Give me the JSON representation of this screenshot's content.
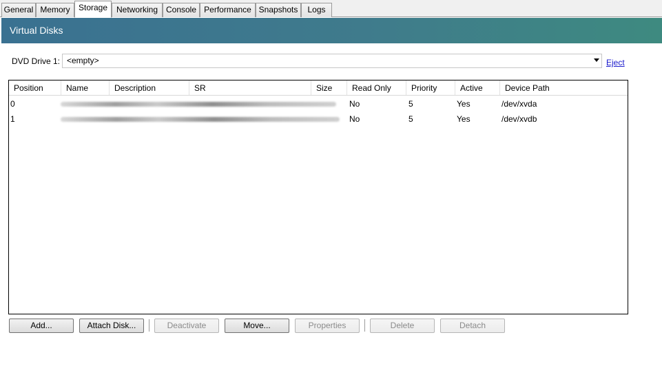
{
  "tabs": [
    {
      "label": "General"
    },
    {
      "label": "Memory"
    },
    {
      "label": "Storage",
      "active": true
    },
    {
      "label": "Networking"
    },
    {
      "label": "Console"
    },
    {
      "label": "Performance"
    },
    {
      "label": "Snapshots"
    },
    {
      "label": "Logs"
    }
  ],
  "header": {
    "title": "Virtual Disks"
  },
  "dvd": {
    "label": "DVD Drive 1:",
    "value": "<empty>",
    "eject_label": "Eject"
  },
  "grid": {
    "columns": [
      "Position",
      "Name",
      "Description",
      "SR",
      "Size",
      "Read Only",
      "Priority",
      "Active",
      "Device Path"
    ],
    "rows": [
      {
        "position": "0",
        "read_only": "No",
        "priority": "5",
        "active": "Yes",
        "device_path": "/dev/xvda"
      },
      {
        "position": "1",
        "read_only": "No",
        "priority": "5",
        "active": "Yes",
        "device_path": "/dev/xvdb"
      }
    ]
  },
  "buttons": {
    "add": "Add...",
    "attach_disk": "Attach Disk...",
    "deactivate": "Deactivate",
    "move": "Move...",
    "properties": "Properties",
    "delete": "Delete",
    "detach": "Detach"
  },
  "colors": {
    "header_start": "#3a7191",
    "header_end": "#3e8a80",
    "link": "#1a1acc"
  }
}
